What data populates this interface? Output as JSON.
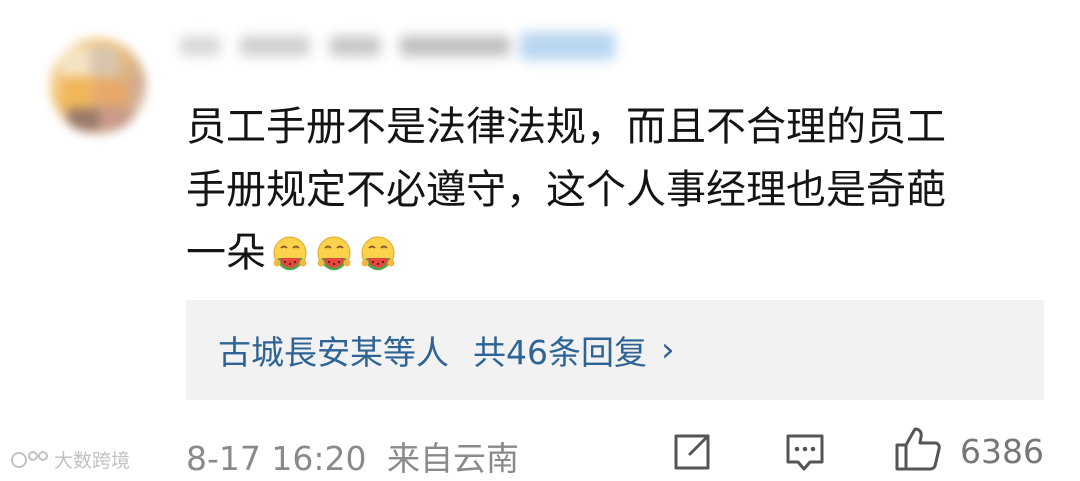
{
  "comment": {
    "lines": [
      "员工手册不是法律法规，而且不合理的员工",
      "手册规定不必遵守，这个人事经理也是奇葩",
      "一朵"
    ],
    "emojis": [
      "watermelon-eating-emoji",
      "watermelon-eating-emoji",
      "watermelon-eating-emoji"
    ]
  },
  "replies": {
    "names": "古城長安某",
    "suffix": "等人",
    "count_text": "共46条回复",
    "chevron": "›"
  },
  "footer": {
    "time": "8-17 16:20",
    "location": "来自云南",
    "like_count": "6386"
  },
  "watermark": {
    "text": "大数跨境"
  },
  "colors": {
    "text": "#141414",
    "link": "#2e6396",
    "meta": "#8a8a8a",
    "reply_bg": "#f2f2f2"
  }
}
